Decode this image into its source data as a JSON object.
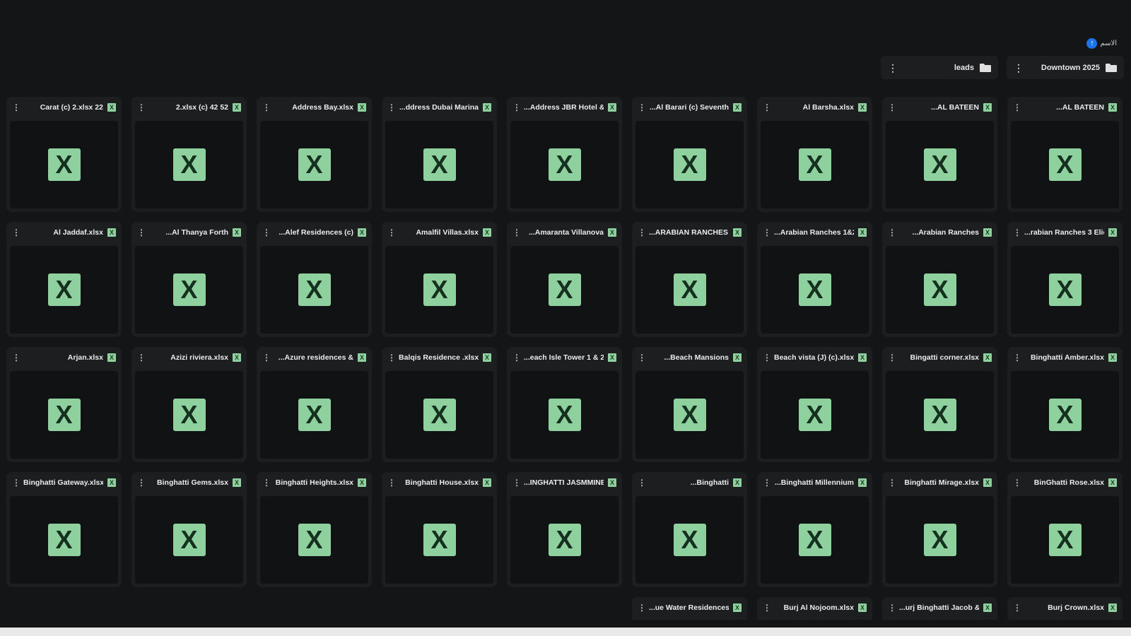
{
  "sort": {
    "label": "الاسم",
    "direction": "↑"
  },
  "folders": [
    {
      "name": "Downtown 2025"
    },
    {
      "name": "leads"
    }
  ],
  "files": [
    {
      "name": "...AL BATEEN"
    },
    {
      "name": "...AL BATEEN"
    },
    {
      "name": "Al Barsha.xlsx"
    },
    {
      "name": "...Al Barari (c) Seventh"
    },
    {
      "name": "...Address JBR Hotel &"
    },
    {
      "name": "...ddress Dubai Marina"
    },
    {
      "name": "Address Bay.xlsx"
    },
    {
      "name": "2.xlsx (c) 42 52"
    },
    {
      "name": "Carat (c) 2.xlsx 22"
    },
    {
      "name": "...rabian Ranches 3 Elie"
    },
    {
      "name": "...Arabian Ranches"
    },
    {
      "name": "...Arabian Ranches 1&2"
    },
    {
      "name": "...ARABIAN RANCHES -"
    },
    {
      "name": "...Amaranta Villanova"
    },
    {
      "name": "Amalfil Villas.xlsx"
    },
    {
      "name": "...Alef Residences (c)"
    },
    {
      "name": "...Al Thanya Forth"
    },
    {
      "name": "Al Jaddaf.xlsx"
    },
    {
      "name": "Binghatti Amber.xlsx"
    },
    {
      "name": "Bingatti corner.xlsx"
    },
    {
      "name": "Beach vista (J) (c).xlsx"
    },
    {
      "name": "...Beach Mansions"
    },
    {
      "name": "...each Isle Tower 1 & 2"
    },
    {
      "name": "Balqis Residence .xlsx"
    },
    {
      "name": "...Azure residences &"
    },
    {
      "name": "Azizi riviera.xlsx"
    },
    {
      "name": "Arjan.xlsx"
    },
    {
      "name": "BinGhatti Rose.xlsx"
    },
    {
      "name": "Binghatti Mirage.xlsx"
    },
    {
      "name": "...Binghatti Millennium"
    },
    {
      "name": "...Binghatti"
    },
    {
      "name": "...INGHATTI JASMMINE"
    },
    {
      "name": "Binghatti House.xlsx"
    },
    {
      "name": "Binghatti Heights.xlsx"
    },
    {
      "name": "Binghatti Gems.xlsx"
    },
    {
      "name": "Binghatti Gateway.xlsx"
    },
    {
      "name": "Burj Crown.xlsx"
    },
    {
      "name": "...urj Binghatti Jacob &"
    },
    {
      "name": "Burj Al Nojoom.xlsx"
    },
    {
      "name": "...ue Water Residences"
    }
  ],
  "icons": {
    "menu": "⋮",
    "excel_letter": "X"
  }
}
